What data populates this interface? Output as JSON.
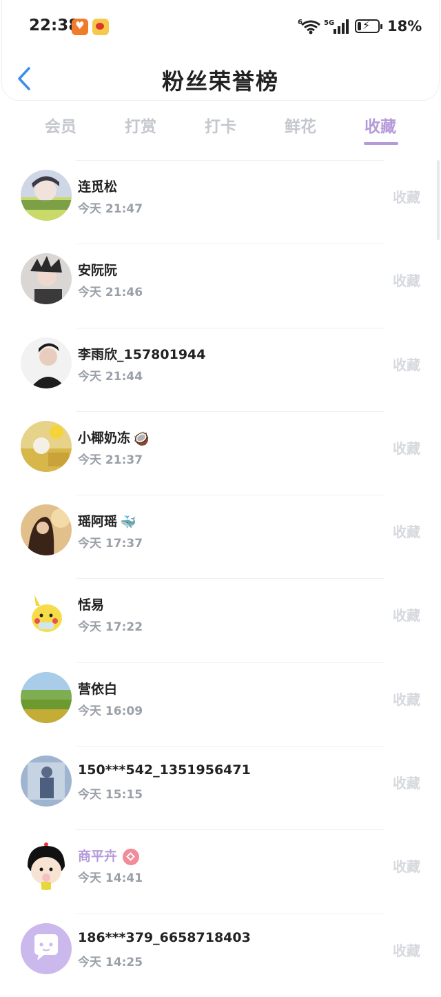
{
  "status_bar": {
    "time": "22:38",
    "battery_percent": "18%",
    "battery_level": 0.18,
    "network_5g": "5G",
    "network_6": "6"
  },
  "header": {
    "title": "粉丝荣誉榜",
    "back_icon": "chevron-left-icon"
  },
  "tabs": [
    {
      "label": "会员",
      "active": false
    },
    {
      "label": "打赏",
      "active": false
    },
    {
      "label": "打卡",
      "active": false
    },
    {
      "label": "鲜花",
      "active": false
    },
    {
      "label": "收藏",
      "active": true
    }
  ],
  "colors": {
    "accent": "#b59ad9",
    "inactive_tab": "#c4c7cd",
    "time_text": "#9aa0a8",
    "action_text": "#d6d9de"
  },
  "list": [
    {
      "name": "连觅松",
      "time": "今天 21:47",
      "action": "收藏"
    },
    {
      "name": "安阮阮",
      "time": "今天 21:46",
      "action": "收藏"
    },
    {
      "name": "李雨欣_157801944",
      "time": "今天 21:44",
      "action": "收藏"
    },
    {
      "name": "小椰奶冻",
      "emoji": "🥥",
      "time": "今天 21:37",
      "action": "收藏"
    },
    {
      "name": "瑶阿瑶",
      "emoji": "🐳",
      "time": "今天 17:37",
      "action": "收藏"
    },
    {
      "name": "恬易",
      "time": "今天 17:22",
      "action": "收藏"
    },
    {
      "name": "营依白",
      "time": "今天 16:09",
      "action": "收藏"
    },
    {
      "name": "150***542_1351956471",
      "time": "今天 15:15",
      "action": "收藏"
    },
    {
      "name": "商平卉",
      "vip": true,
      "time": "今天 14:41",
      "action": "收藏"
    },
    {
      "name": "186***379_6658718403",
      "time": "今天 14:25",
      "action": "收藏"
    }
  ]
}
